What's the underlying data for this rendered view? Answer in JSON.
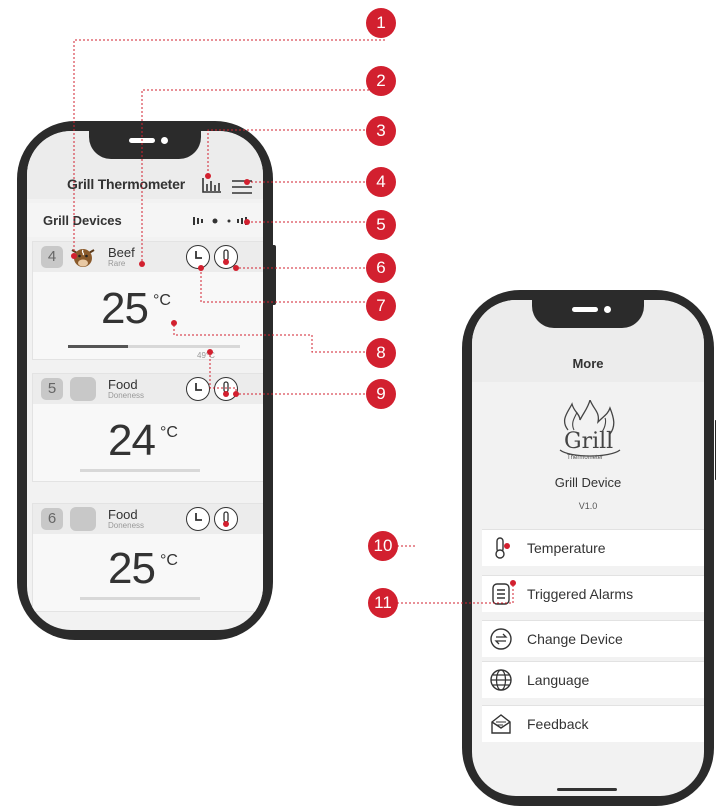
{
  "left_screen": {
    "title": "Grill Thermometer",
    "subtitle": "Grill Devices",
    "cards": [
      {
        "slot": "4",
        "food": "Beef",
        "doneness": "Rare",
        "temp": "25",
        "unit": "°C",
        "progress": 0.35,
        "target": "49°C"
      },
      {
        "slot": "5",
        "food": "Food",
        "doneness": "Doneness",
        "temp": "24",
        "unit": "°C",
        "progress": 0.0,
        "target": ""
      },
      {
        "slot": "6",
        "food": "Food",
        "doneness": "Doneness",
        "temp": "25",
        "unit": "°C",
        "progress": 0.0,
        "target": ""
      }
    ]
  },
  "right_screen": {
    "title": "More",
    "logo_text": "Grill",
    "logo_sub": "Thermometer",
    "device_name": "Grill Device",
    "version": "V1.0",
    "menu": [
      {
        "label": "Temperature",
        "icon": "thermometer-icon"
      },
      {
        "label": "Triggered Alarms",
        "icon": "alarm-list-icon"
      },
      {
        "label": "Change Device",
        "icon": "change-device-icon"
      },
      {
        "label": "Language",
        "icon": "globe-icon"
      },
      {
        "label": "Feedback",
        "icon": "mail-icon"
      }
    ]
  },
  "callouts": [
    "1",
    "2",
    "3",
    "4",
    "5",
    "6",
    "7",
    "8",
    "9",
    "10",
    "11"
  ],
  "colors": {
    "accent": "#d2202f",
    "frame": "#2b2b2b",
    "screen": "#f2f2f2"
  }
}
